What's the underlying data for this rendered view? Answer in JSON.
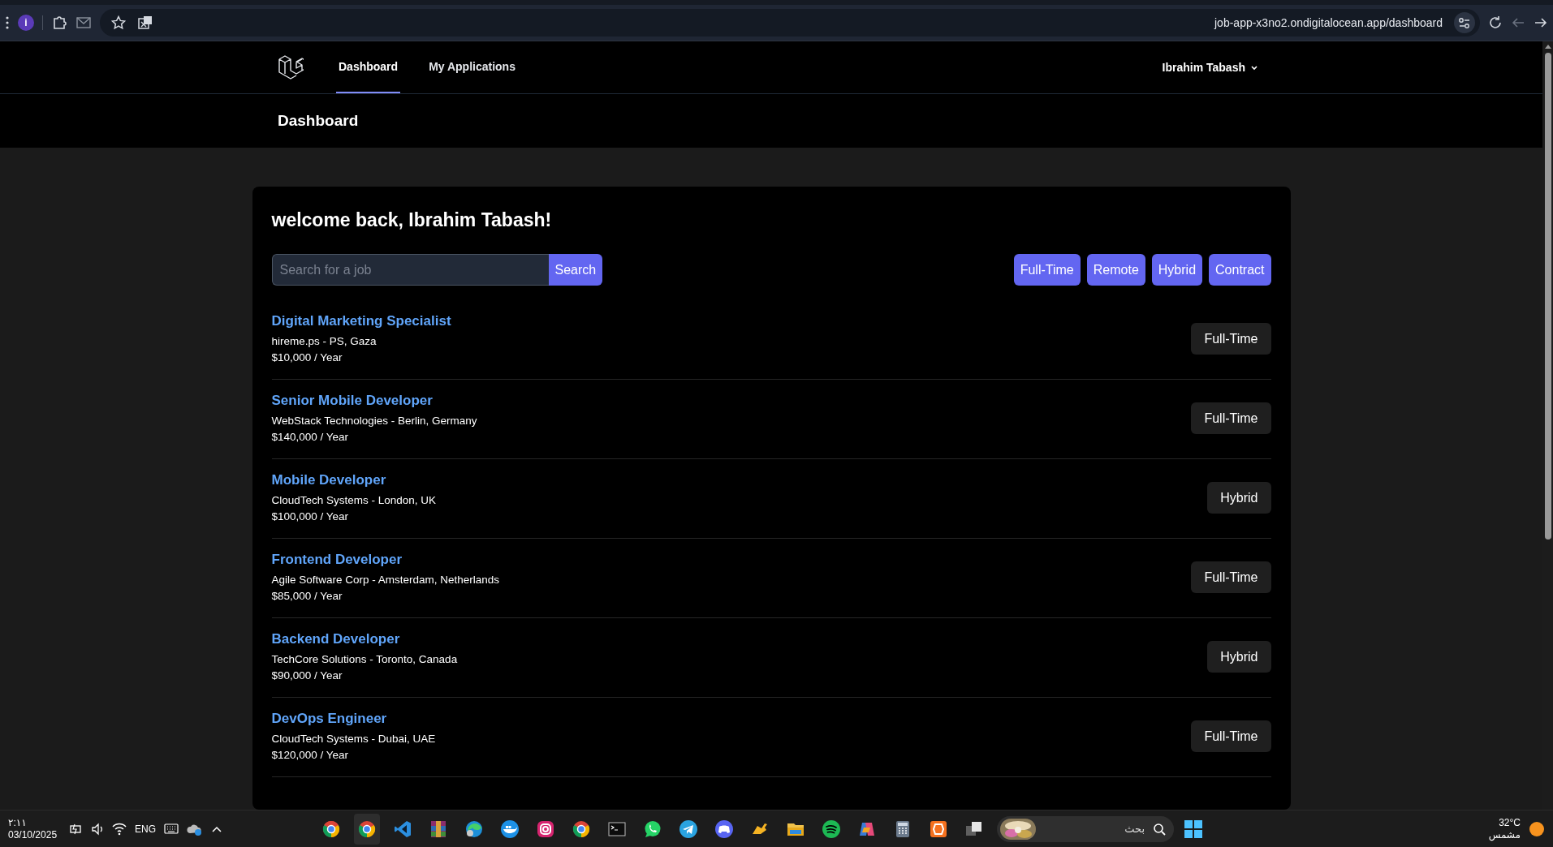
{
  "browser": {
    "profile_initial": "i",
    "url": "job-app-x3no2.ondigitalocean.app/dashboard"
  },
  "nav": {
    "links": [
      {
        "label": "Dashboard",
        "selected": true
      },
      {
        "label": "My Applications",
        "selected": false
      }
    ],
    "user": "Ibrahim Tabash"
  },
  "header": {
    "title": "Dashboard"
  },
  "welcome": "welcome back, Ibrahim Tabash!",
  "search": {
    "placeholder": "Search for a job",
    "button": "Search"
  },
  "filters": [
    "Full-Time",
    "Remote",
    "Hybrid",
    "Contract"
  ],
  "jobs": [
    {
      "title": "Digital Marketing Specialist",
      "company_location": "hireme.ps - PS, Gaza",
      "salary": "$10,000 / Year",
      "type": "Full-Time"
    },
    {
      "title": "Senior Mobile Developer",
      "company_location": "WebStack Technologies - Berlin, Germany",
      "salary": "$140,000 / Year",
      "type": "Full-Time"
    },
    {
      "title": "Mobile Developer",
      "company_location": "CloudTech Systems - London, UK",
      "salary": "$100,000 / Year",
      "type": "Hybrid"
    },
    {
      "title": "Frontend Developer",
      "company_location": "Agile Software Corp - Amsterdam, Netherlands",
      "salary": "$85,000 / Year",
      "type": "Full-Time"
    },
    {
      "title": "Backend Developer",
      "company_location": "TechCore Solutions - Toronto, Canada",
      "salary": "$90,000 / Year",
      "type": "Hybrid"
    },
    {
      "title": "DevOps Engineer",
      "company_location": "CloudTech Systems - Dubai, UAE",
      "salary": "$120,000 / Year",
      "type": "Full-Time"
    }
  ],
  "taskbar": {
    "time": "٢:١١",
    "date": "03/10/2025",
    "language": "ENG",
    "search_placeholder": "بحث",
    "temperature": "32°C",
    "weather": "مشمس"
  }
}
